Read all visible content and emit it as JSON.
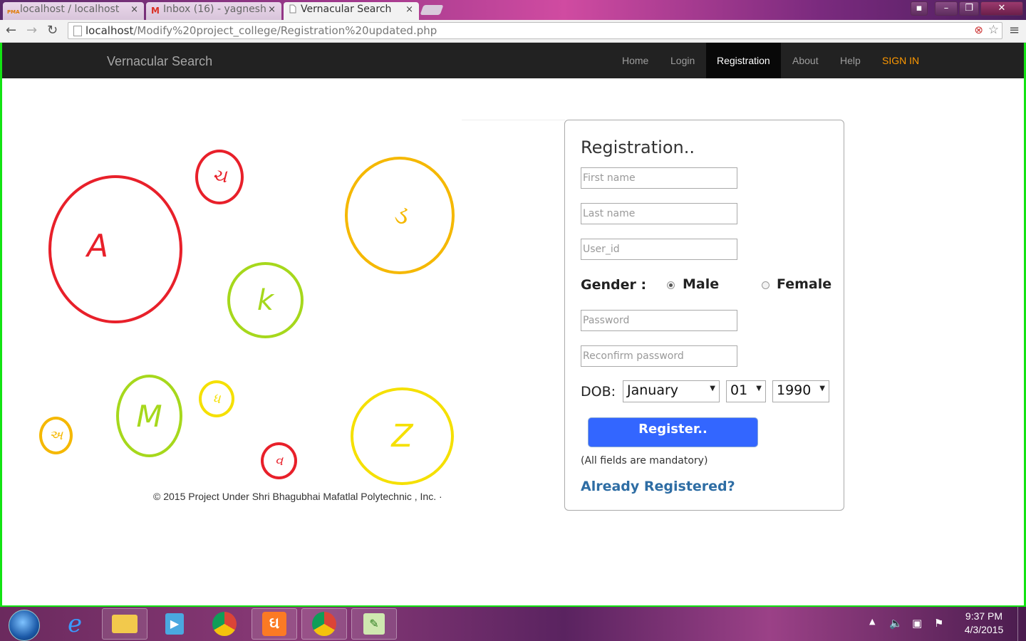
{
  "browser": {
    "tabs": [
      {
        "label": "localhost / localhost",
        "icon": "PMA",
        "active": false
      },
      {
        "label": "Inbox (16) - yagnesh",
        "icon": "M",
        "active": false
      },
      {
        "label": "Vernacular Search",
        "icon": "page",
        "active": true
      }
    ],
    "url_host": "localhost",
    "url_path": "/Modify%20project_college/Registration%20updated.php"
  },
  "navbar": {
    "brand": "Vernacular Search",
    "links": [
      "Home",
      "Login",
      "Registration",
      "About",
      "Help",
      "SIGN IN"
    ],
    "active": "Registration"
  },
  "circles": [
    {
      "letter": "A",
      "color": "#e8202a"
    },
    {
      "letter": "ચ",
      "color": "#e8202a"
    },
    {
      "letter": "ડ",
      "color": "#f5b800"
    },
    {
      "letter": "k",
      "color": "#a6d81c"
    },
    {
      "letter": "M",
      "color": "#a6d81c"
    },
    {
      "letter": "ધ",
      "color": "#f5e000"
    },
    {
      "letter": "અ",
      "color": "#f5b800"
    },
    {
      "letter": "વ",
      "color": "#e8202a"
    },
    {
      "letter": "Z",
      "color": "#f5e000"
    }
  ],
  "footer": "© 2015 Project Under Shri Bhagubhai Mafatlal Polytechnic , Inc. ·",
  "form": {
    "title": "Registration..",
    "first_name_placeholder": "First name",
    "last_name_placeholder": "Last name",
    "user_id_placeholder": "User_id",
    "gender_label": "Gender  :",
    "gender_male": "Male",
    "gender_female": "Female",
    "gender_selected": "Male",
    "password_placeholder": "Password",
    "reconfirm_placeholder": "Reconfirm password",
    "dob_label": "DOB:",
    "dob_month": "January",
    "dob_day": "01",
    "dob_year": "1990",
    "register_label": "Register..",
    "note": "(All fields are mandatory)",
    "already_link": "Already Registered?"
  },
  "taskbar": {
    "time": "9:37 PM",
    "date": "4/3/2015"
  }
}
